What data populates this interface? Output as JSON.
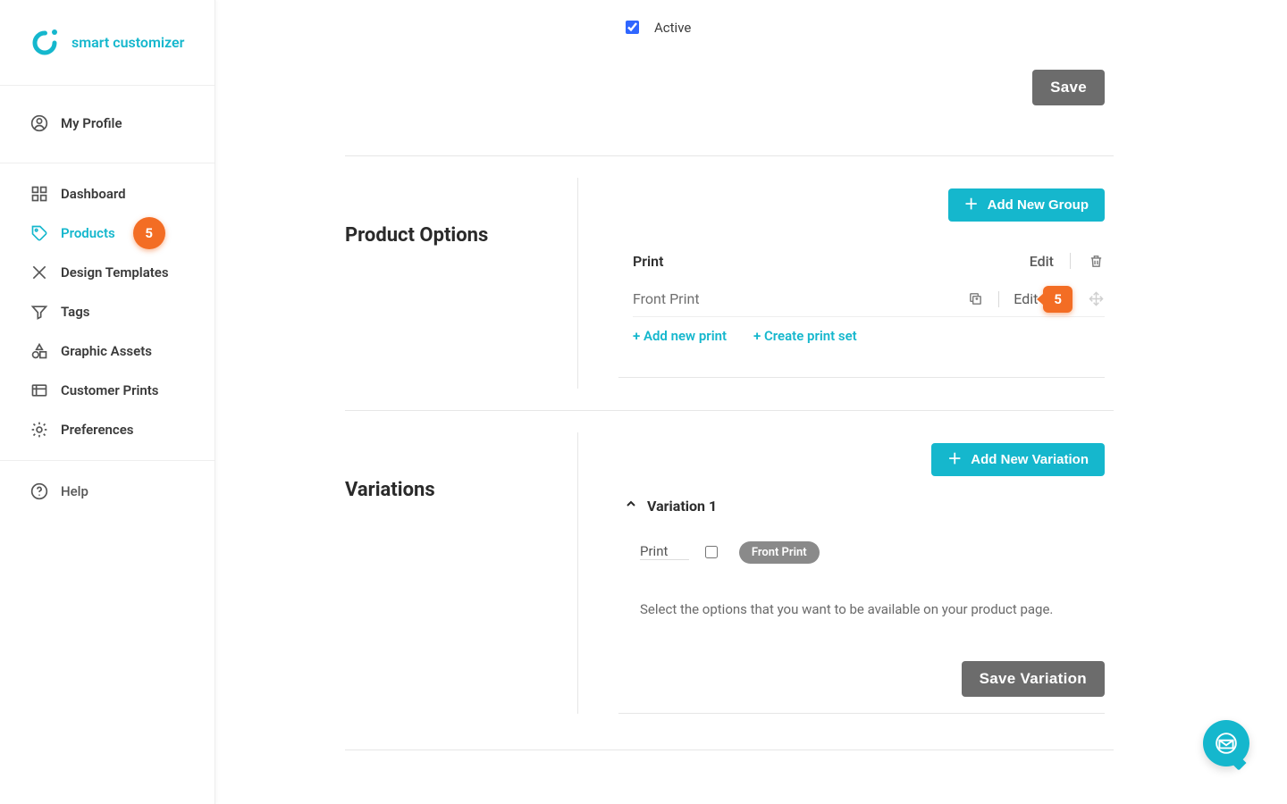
{
  "brand": "smart customizer",
  "sidebar": {
    "profile": "My Profile",
    "items": [
      {
        "label": "Dashboard"
      },
      {
        "label": "Products",
        "badge": "5",
        "active": true
      },
      {
        "label": "Design Templates"
      },
      {
        "label": "Tags"
      },
      {
        "label": "Graphic Assets"
      },
      {
        "label": "Customer Prints"
      },
      {
        "label": "Preferences"
      }
    ],
    "help": "Help"
  },
  "top": {
    "active_label": "Active",
    "active_checked": true,
    "save": "Save"
  },
  "options": {
    "title": "Product Options",
    "add_group": "Add New Group",
    "group": {
      "name": "Print",
      "edit": "Edit"
    },
    "print": {
      "name": "Front Print",
      "edit": "Edit",
      "pointer": "5"
    },
    "sub": {
      "add_print": "+ Add new print",
      "create_set": "+ Create print set"
    }
  },
  "variations": {
    "title": "Variations",
    "add_variation": "Add New Variation",
    "item_title": "Variation 1",
    "print_label": "Print",
    "pill": "Front Print",
    "note": "Select the options that you want to be available on your product page.",
    "save": "Save Variation"
  }
}
